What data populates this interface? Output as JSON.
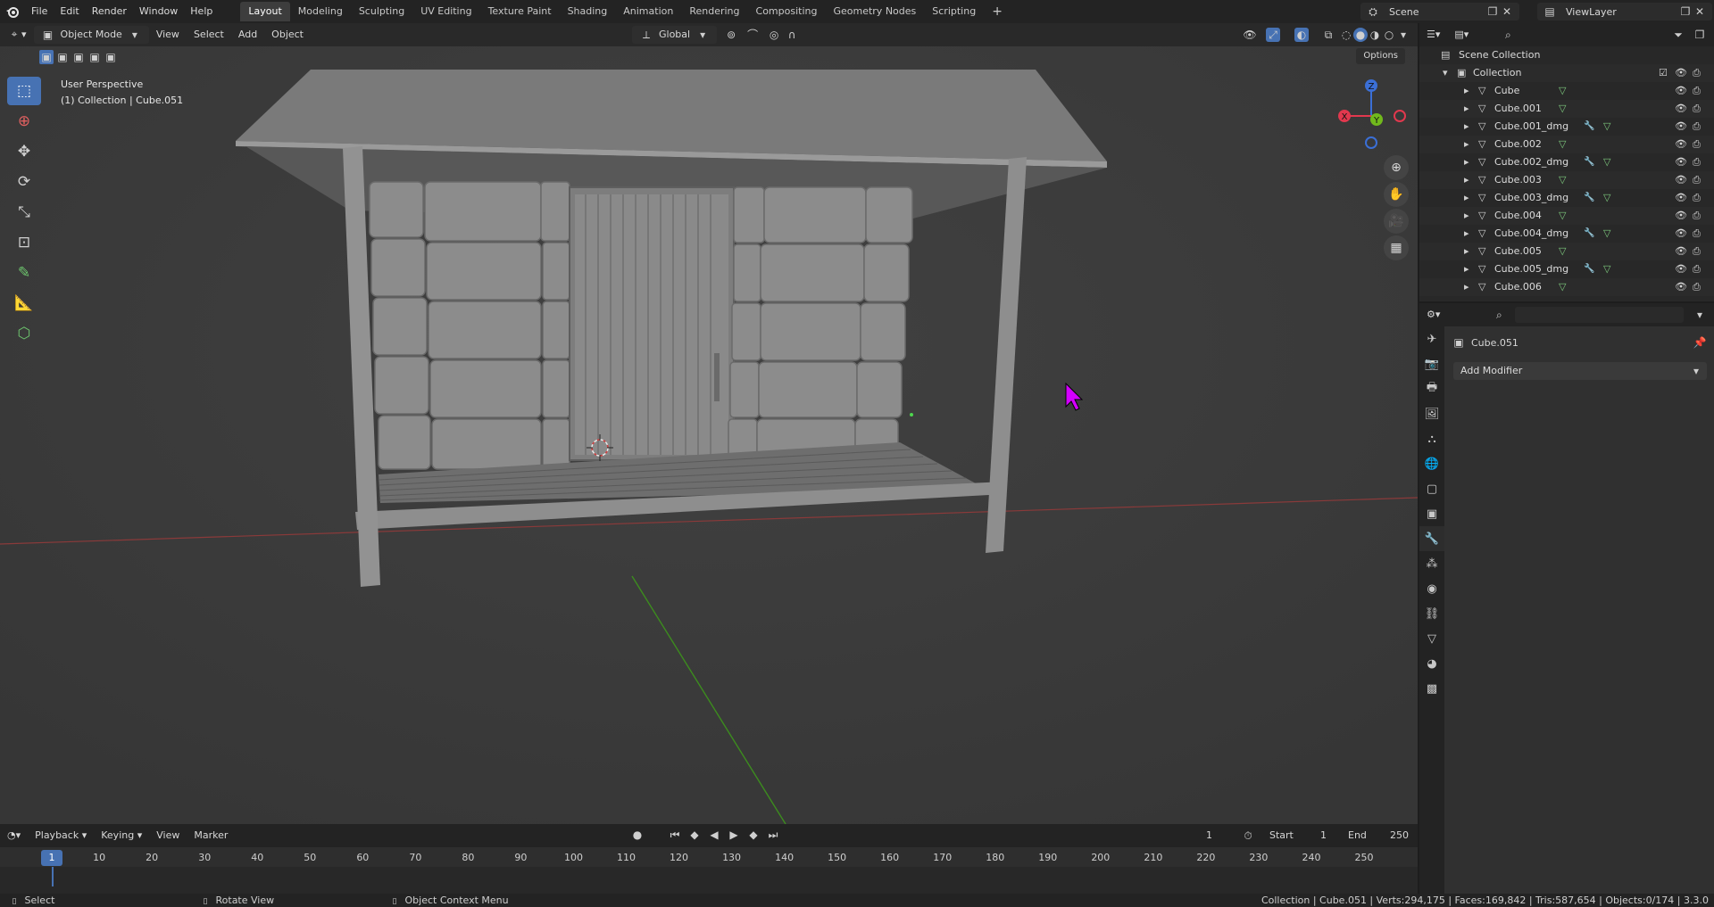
{
  "menu": {
    "items": [
      "File",
      "Edit",
      "Render",
      "Window",
      "Help"
    ],
    "workspaces": [
      "Layout",
      "Modeling",
      "Sculpting",
      "UV Editing",
      "Texture Paint",
      "Shading",
      "Animation",
      "Rendering",
      "Compositing",
      "Geometry Nodes",
      "Scripting"
    ],
    "active_workspace": "Layout",
    "add_tab": "+"
  },
  "scene": {
    "name": "Scene",
    "view_layer": "ViewLayer"
  },
  "viewport": {
    "mode": "Object Mode",
    "menus": [
      "View",
      "Select",
      "Add",
      "Object"
    ],
    "transform_orientation": "Global",
    "options_label": "Options",
    "perspective_label": "User Perspective",
    "collection_label": "(1) Collection | Cube.051",
    "gizmo_axes": {
      "x": "X",
      "y": "Y",
      "z": "Z"
    }
  },
  "timeline": {
    "menus": [
      "Playback",
      "Keying",
      "View",
      "Marker"
    ],
    "current_frame": "1",
    "start_label": "Start",
    "start_value": "1",
    "end_label": "End",
    "end_value": "250",
    "ticks": [
      "1",
      "10",
      "20",
      "30",
      "40",
      "50",
      "60",
      "70",
      "80",
      "90",
      "100",
      "110",
      "120",
      "130",
      "140",
      "150",
      "160",
      "170",
      "180",
      "190",
      "200",
      "210",
      "220",
      "230",
      "240",
      "250"
    ]
  },
  "statusbar": {
    "select": "Select",
    "rotate": "Rotate View",
    "context": "Object Context Menu",
    "stats": "Collection | Cube.051 | Verts:294,175 | Faces:169,842 | Tris:587,654 | Objects:0/174 | 3.3.0"
  },
  "outliner": {
    "root": "Scene Collection",
    "collection": "Collection",
    "items": [
      {
        "name": "Cube",
        "modifier": false
      },
      {
        "name": "Cube.001",
        "modifier": false
      },
      {
        "name": "Cube.001_dmg",
        "modifier": true
      },
      {
        "name": "Cube.002",
        "modifier": false
      },
      {
        "name": "Cube.002_dmg",
        "modifier": true
      },
      {
        "name": "Cube.003",
        "modifier": false
      },
      {
        "name": "Cube.003_dmg",
        "modifier": true
      },
      {
        "name": "Cube.004",
        "modifier": false
      },
      {
        "name": "Cube.004_dmg",
        "modifier": true
      },
      {
        "name": "Cube.005",
        "modifier": false
      },
      {
        "name": "Cube.005_dmg",
        "modifier": true
      },
      {
        "name": "Cube.006",
        "modifier": false
      }
    ]
  },
  "properties": {
    "object_name": "Cube.051",
    "add_modifier": "Add Modifier",
    "active_tab": "modifiers"
  },
  "colors": {
    "accent": "#4772b3",
    "axis_x": "#e2384e",
    "axis_y": "#71b91c",
    "axis_z": "#3b6fd6",
    "cursor": "#d400ff"
  }
}
